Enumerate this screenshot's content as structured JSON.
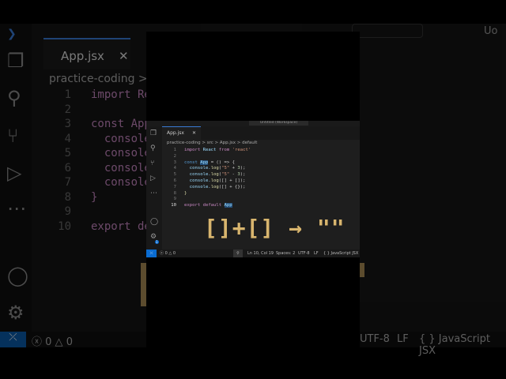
{
  "background_editor": {
    "tab": "App.jsx",
    "breadcrumb": "practice-coding > src",
    "line_numbers": [
      "1",
      "2",
      "3",
      "4",
      "5",
      "6",
      "7",
      "8",
      "9",
      "10"
    ],
    "code": [
      "import Re",
      "",
      "const App",
      "  console",
      "  console",
      "  console",
      "  console",
      "}",
      "",
      "export de"
    ],
    "status": {
      "errors": "0",
      "warnings": "0",
      "encoding": "UTF-8",
      "eol": "LF",
      "language": "{ } JavaScript JSX"
    },
    "title_right": "Uo"
  },
  "editor": {
    "title": "Untitled (Workspace)",
    "tab": "App.jsx",
    "breadcrumb": "practice-coding > src > App.jsx > default",
    "line_numbers": [
      "1",
      "2",
      "3",
      "4",
      "5",
      "6",
      "7",
      "8",
      "9",
      "10"
    ],
    "code": [
      [
        {
          "t": "import ",
          "c": "kw2"
        },
        {
          "t": "React ",
          "c": "var"
        },
        {
          "t": "from ",
          "c": "kw2"
        },
        {
          "t": "'react'",
          "c": "str"
        }
      ],
      [],
      [
        {
          "t": "const ",
          "c": "kw"
        },
        {
          "t": "App",
          "c": "var hl"
        },
        {
          "t": " = () => {",
          "c": ""
        }
      ],
      [
        {
          "t": "  console.",
          "c": "var"
        },
        {
          "t": "log",
          "c": "fn"
        },
        {
          "t": "(",
          "c": ""
        },
        {
          "t": "\"5\"",
          "c": "str"
        },
        {
          "t": " + ",
          "c": ""
        },
        {
          "t": "3",
          "c": "num"
        },
        {
          "t": ");",
          "c": ""
        }
      ],
      [
        {
          "t": "  console.",
          "c": "var"
        },
        {
          "t": "log",
          "c": "fn"
        },
        {
          "t": "(",
          "c": ""
        },
        {
          "t": "\"5\"",
          "c": "str"
        },
        {
          "t": " - ",
          "c": ""
        },
        {
          "t": "3",
          "c": "num"
        },
        {
          "t": ");",
          "c": ""
        }
      ],
      [
        {
          "t": "  console.",
          "c": "var"
        },
        {
          "t": "log",
          "c": "fn"
        },
        {
          "t": "([] + []);",
          "c": ""
        }
      ],
      [
        {
          "t": "  console.",
          "c": "var"
        },
        {
          "t": "log",
          "c": "fn"
        },
        {
          "t": "([] + {});",
          "c": ""
        }
      ],
      [
        {
          "t": "}",
          "c": "fn"
        }
      ],
      [],
      [
        {
          "t": "export ",
          "c": "kw2"
        },
        {
          "t": "default ",
          "c": "kw2"
        },
        {
          "t": "App",
          "c": "var hl"
        }
      ]
    ],
    "overlay_text": "[]+[] → \"\"",
    "status": {
      "errors": "0",
      "warnings": "0",
      "position": "Ln 10, Col 19",
      "spaces": "Spaces: 2",
      "encoding": "UTF-8",
      "eol": "LF",
      "language": "{ } JavaScript JSX"
    },
    "settings_badge": "1"
  }
}
